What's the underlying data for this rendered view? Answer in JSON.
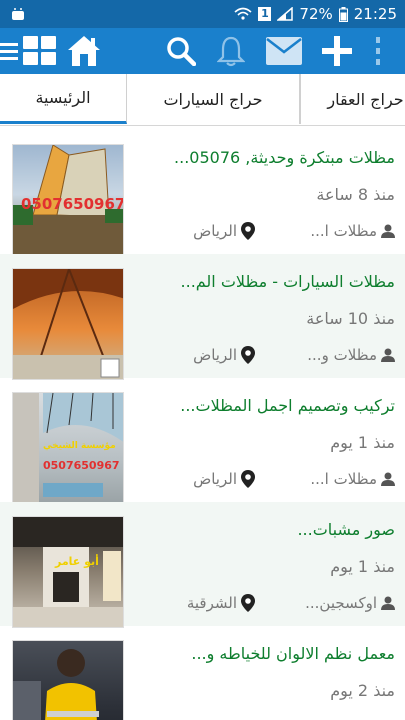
{
  "status_bar": {
    "battery": "72%",
    "time": "21:25",
    "notification_badge": "1"
  },
  "tabs": [
    {
      "label": "حراج العقار"
    },
    {
      "label": "حراج السيارات"
    },
    {
      "label": "الرئيسية"
    }
  ],
  "listings": [
    {
      "title": "مظلات مبتكرة وحديثة, 05076...",
      "time": "منذ 8 ساعة",
      "category": "مظلات ا...",
      "location": "الرياض",
      "thumb_label": "0507650967"
    },
    {
      "title": "مظلات السيارات - مظلات الم...",
      "time": "منذ 10 ساعة",
      "category": "مظلات و...",
      "location": "الرياض",
      "thumb_label": ""
    },
    {
      "title": "تركيب وتصميم اجمل المظلات...",
      "time": "منذ 1 يوم",
      "category": "مظلات ا...",
      "location": "الرياض",
      "thumb_label": "0507650967",
      "thumb_caption": "مؤسسة الشيخي"
    },
    {
      "title": "صور مشبات...",
      "time": "منذ 1 يوم",
      "category": "اوكسجين...",
      "location": "الشرقية",
      "thumb_label": "أبو عامر"
    },
    {
      "title": "معمل نظم الالوان للخياطه و...",
      "time": "منذ 2 يوم",
      "category": "",
      "location": "",
      "thumb_label": ""
    }
  ],
  "colors": {
    "status_bar": "#1468a8",
    "app_bar": "#1a80cc",
    "title_green": "#0e7e2e",
    "meta_gray": "#777777",
    "alt_row": "#f2f7f4"
  },
  "icons": [
    "menu-icon",
    "grid-icon",
    "home-icon",
    "search-icon",
    "bell-icon",
    "mail-icon",
    "plus-icon",
    "more-vert-icon",
    "user-icon",
    "location-pin-icon"
  ]
}
